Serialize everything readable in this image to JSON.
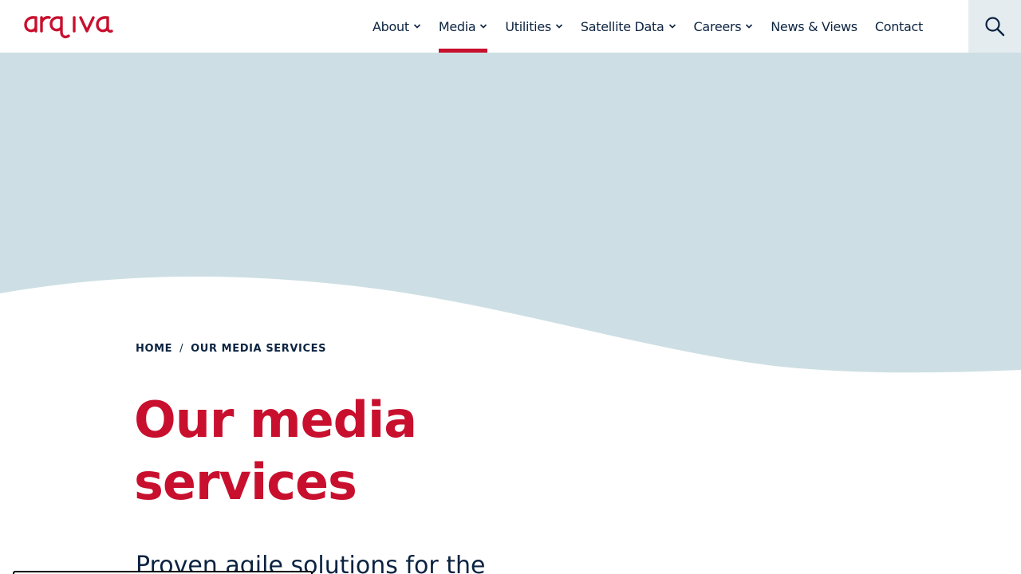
{
  "brand": {
    "name": "arqiva",
    "color": "#c8102e"
  },
  "nav": {
    "items": [
      {
        "label": "About",
        "has_dropdown": true,
        "active": false
      },
      {
        "label": "Media",
        "has_dropdown": true,
        "active": true
      },
      {
        "label": "Utilities",
        "has_dropdown": true,
        "active": false
      },
      {
        "label": "Satellite Data",
        "has_dropdown": true,
        "active": false
      },
      {
        "label": "Careers",
        "has_dropdown": true,
        "active": false
      },
      {
        "label": "News & Views",
        "has_dropdown": false,
        "active": false
      },
      {
        "label": "Contact",
        "has_dropdown": false,
        "active": false
      }
    ],
    "search_icon": "search-icon"
  },
  "breadcrumb": {
    "items": [
      "HOME",
      "OUR MEDIA SERVICES"
    ],
    "separator": "/"
  },
  "page": {
    "title_line1": "Our media",
    "title_line2": "services",
    "intro": "Proven agile solutions for the"
  },
  "colors": {
    "accent": "#c8102e",
    "text": "#0b2341",
    "hero_background": "#cddfe4",
    "search_background": "#e4ecef"
  }
}
